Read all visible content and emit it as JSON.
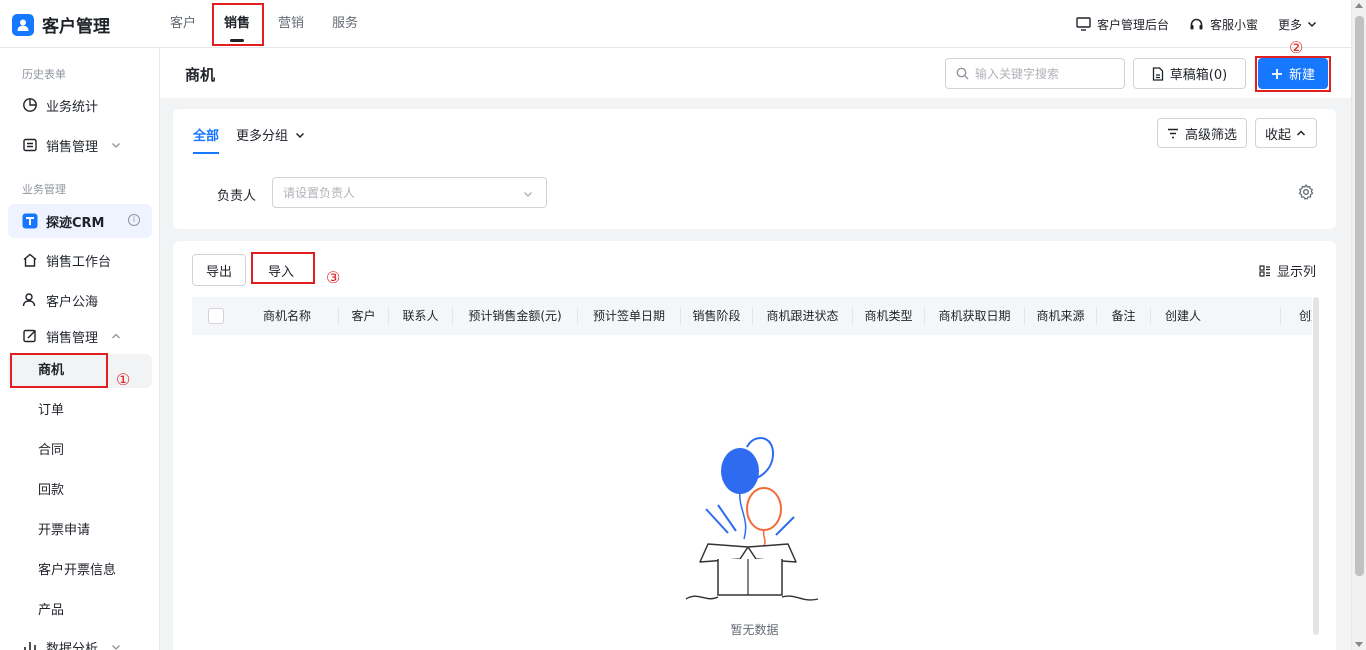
{
  "app": {
    "name": "客户管理"
  },
  "topnav": {
    "tabs": [
      {
        "label": "客户",
        "active": false
      },
      {
        "label": "销售",
        "active": true
      },
      {
        "label": "营销",
        "active": false
      },
      {
        "label": "服务",
        "active": false
      }
    ],
    "right": {
      "admin": "客户管理后台",
      "support": "客服小蜜",
      "more": "更多"
    }
  },
  "sidebar": {
    "history_group": "历史表单",
    "history_items": [
      "业务统计",
      "销售管理"
    ],
    "business_group": "业务管理",
    "crm": "探迹CRM",
    "items": [
      "销售工作台",
      "客户公海",
      "销售管理"
    ],
    "subitems": [
      "商机",
      "订单",
      "合同",
      "回款",
      "开票申请",
      "客户开票信息",
      "产品"
    ],
    "active_subitem": "商机",
    "last_item": "数据分析"
  },
  "header": {
    "title": "商机",
    "search_placeholder": "输入关键字搜索",
    "drafts_label": "草稿箱(0)",
    "new_label": "新建"
  },
  "filter": {
    "tabs": [
      "全部",
      "更多分组"
    ],
    "advanced_label": "高级筛选",
    "collapse_label": "收起",
    "owner_label": "负责人",
    "owner_placeholder": "请设置负责人"
  },
  "table": {
    "export_label": "导出",
    "import_label": "导入",
    "display_cols_label": "显示列",
    "columns": [
      "商机名称",
      "客户",
      "联系人",
      "预计销售金额(元)",
      "预计签单日期",
      "销售阶段",
      "商机跟进状态",
      "商机类型",
      "商机获取日期",
      "商机来源",
      "备注",
      "创建人",
      "创建"
    ],
    "empty_text": "暂无数据"
  },
  "annotations": [
    "①",
    "②",
    "③"
  ],
  "colors": {
    "primary": "#1677ff",
    "highlight": "#e02020",
    "balloon_blue": "#2f6bf0",
    "balloon_orange": "#f26b3a"
  }
}
